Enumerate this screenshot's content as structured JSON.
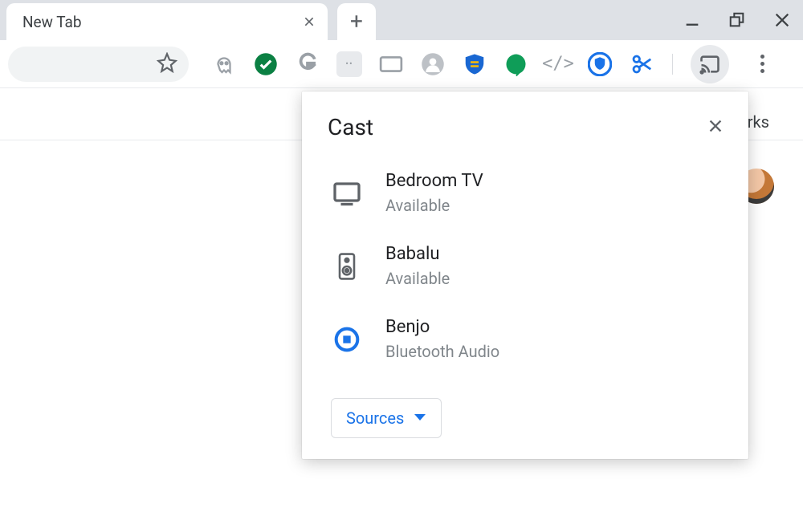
{
  "tabs": {
    "active": {
      "title": "New Tab"
    }
  },
  "cast": {
    "title": "Cast",
    "devices": [
      {
        "name": "Bedroom TV",
        "status": "Available",
        "kind": "tv"
      },
      {
        "name": "Babalu",
        "status": "Available",
        "kind": "speaker"
      },
      {
        "name": "Benjo",
        "status": "Bluetooth Audio",
        "kind": "bluetooth",
        "active": true
      }
    ],
    "sources_label": "Sources"
  },
  "toolbar": {
    "extensions": [
      "ghostery-icon",
      "green-check-icon",
      "google-g-icon",
      "password-manager-icon",
      "rectangle-icon",
      "profile-gray-icon",
      "shield-blue-icon",
      "hangouts-icon",
      "devtools-icon",
      "vpn-shield-icon",
      "scissors-icon"
    ]
  },
  "content": {
    "link_fragment": "rks"
  },
  "colors": {
    "accent_blue": "#1a73e8",
    "text_primary": "#202124",
    "text_secondary": "#5f6368",
    "tabstrip_bg": "#dee1e6"
  }
}
